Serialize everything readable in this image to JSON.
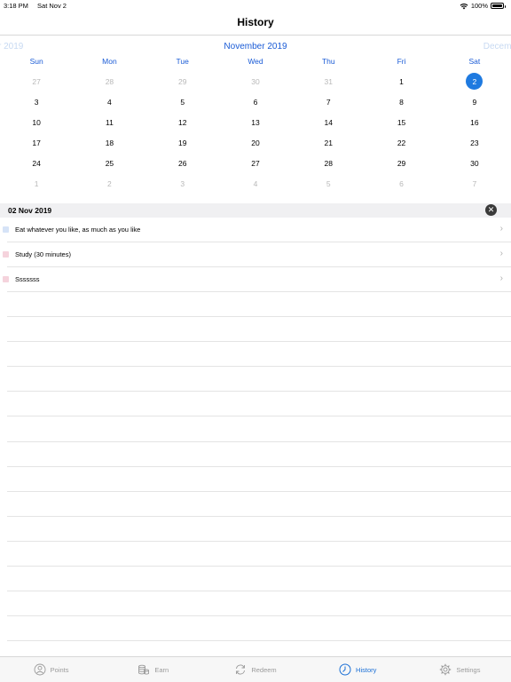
{
  "status_bar": {
    "time": "3:18 PM",
    "date": "Sat Nov 2",
    "battery": "100%"
  },
  "nav": {
    "title": "History"
  },
  "calendar": {
    "prev_month": "r 2019",
    "current_month": "November 2019",
    "next_month": "Decemb",
    "weekdays": [
      "Sun",
      "Mon",
      "Tue",
      "Wed",
      "Thu",
      "Fri",
      "Sat"
    ],
    "weeks": [
      [
        "27",
        "28",
        "29",
        "30",
        "31",
        "1",
        "2"
      ],
      [
        "3",
        "4",
        "5",
        "6",
        "7",
        "8",
        "9"
      ],
      [
        "10",
        "11",
        "12",
        "13",
        "14",
        "15",
        "16"
      ],
      [
        "17",
        "18",
        "19",
        "20",
        "21",
        "22",
        "23"
      ],
      [
        "24",
        "25",
        "26",
        "27",
        "28",
        "29",
        "30"
      ],
      [
        "1",
        "2",
        "3",
        "4",
        "5",
        "6",
        "7"
      ]
    ]
  },
  "selection": {
    "date_label": "02 Nov 2019",
    "clear_glyph": "✕",
    "items": [
      {
        "label": "Eat whatever you like, as much as you like",
        "color": "#d6e3f7"
      },
      {
        "label": "Study (30 minutes)",
        "color": "#f5d3dc"
      },
      {
        "label": "Sssssss",
        "color": "#f5d3dc"
      }
    ]
  },
  "tabs": [
    {
      "label": "Points",
      "icon": "points-icon",
      "active": false
    },
    {
      "label": "Earn",
      "icon": "earn-icon",
      "active": false
    },
    {
      "label": "Redeem",
      "icon": "redeem-icon",
      "active": false
    },
    {
      "label": "History",
      "icon": "history-icon",
      "active": true
    },
    {
      "label": "Settings",
      "icon": "settings-icon",
      "active": false
    }
  ],
  "colors": {
    "accent": "#1a5bd6",
    "selected_day": "#1f7ae0"
  }
}
